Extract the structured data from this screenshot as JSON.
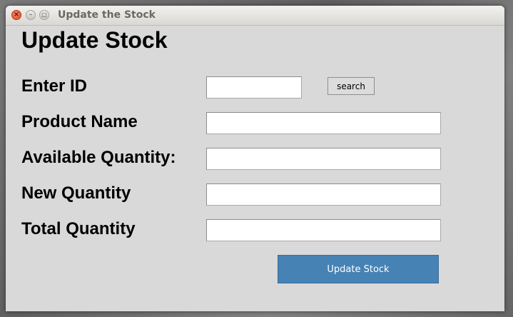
{
  "window": {
    "title": "Update the Stock",
    "close_glyph": "×",
    "minimize_glyph": "–",
    "maximize_glyph": "□"
  },
  "form": {
    "heading": "Update Stock",
    "fields": {
      "enter_id": {
        "label": "Enter ID",
        "value": ""
      },
      "product_name": {
        "label": "Product Name",
        "value": ""
      },
      "available_quantity": {
        "label": "Available Quantity:",
        "value": ""
      },
      "new_quantity": {
        "label": "New Quantity",
        "value": ""
      },
      "total_quantity": {
        "label": "Total Quantity",
        "value": ""
      }
    },
    "search_label": "search",
    "submit_label": "Update Stock"
  },
  "colors": {
    "window_background": "#d9d9d9",
    "submit_button": "#4682b4",
    "submit_text": "#ffffff",
    "close_button": "#e2461f"
  }
}
